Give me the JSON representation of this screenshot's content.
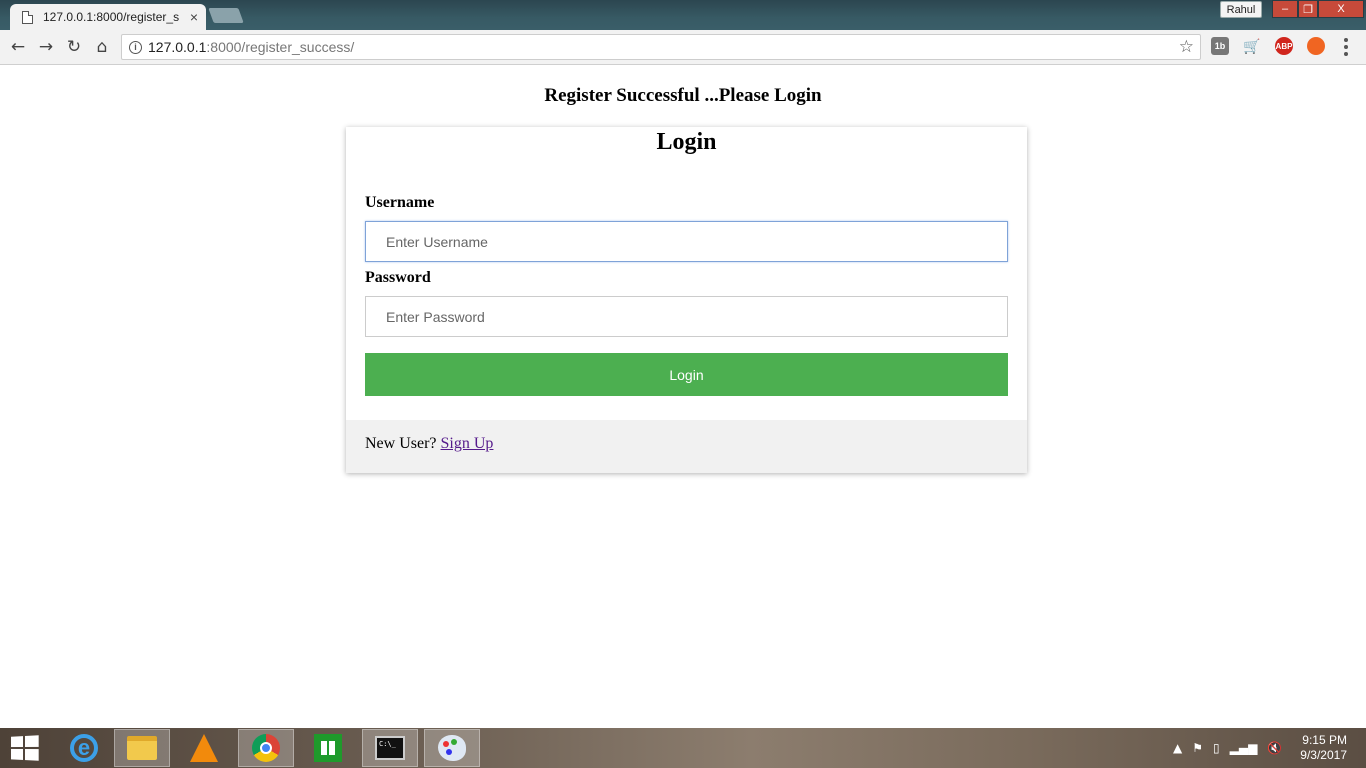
{
  "browser": {
    "tab_title": "127.0.0.1:8000/register_s",
    "tab_close": "×",
    "profile_name": "Rahul",
    "window_controls": {
      "minimize": "–",
      "maximize": "❐",
      "close": "X"
    },
    "address": {
      "host": "127.0.0.1",
      "path": ":8000/register_success/"
    },
    "nav": {
      "back": "←",
      "forward": "→",
      "reload": "↻",
      "home": "⌂"
    },
    "star": "☆",
    "extensions": [
      "1b",
      "🛒",
      "ABP",
      "●"
    ]
  },
  "page": {
    "heading": "Register Successful ...Please Login",
    "card": {
      "title": "Login",
      "username_label": "Username",
      "username_placeholder": "Enter Username",
      "password_label": "Password",
      "password_placeholder": "Enter Password",
      "login_button": "Login",
      "footer_text": "New User? ",
      "signup_link": "Sign Up"
    }
  },
  "taskbar": {
    "apps": [
      "internet-explorer",
      "file-explorer",
      "vlc",
      "chrome",
      "store",
      "command-prompt",
      "paint"
    ],
    "active_app": "chrome",
    "tray": {
      "chevron": "▲",
      "flag": "⚑",
      "signal": "▂▄▆",
      "volume": "🔇"
    },
    "clock": {
      "time": "9:15 PM",
      "date": "9/3/2017"
    }
  }
}
